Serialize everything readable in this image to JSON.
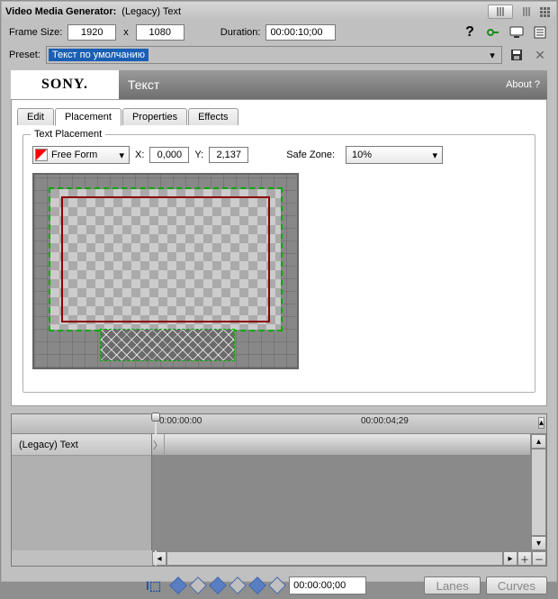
{
  "titlebar": {
    "title": "Video Media Generator:",
    "subtitle": "(Legacy) Text"
  },
  "frame": {
    "label": "Frame Size:",
    "w": "1920",
    "x": "x",
    "h": "1080"
  },
  "duration": {
    "label": "Duration:",
    "value": "00:00:10;00"
  },
  "preset": {
    "label": "Preset:",
    "value": "Текст по умолчанию"
  },
  "sony": {
    "brand": "SONY.",
    "title": "Текст",
    "about": "About  ?"
  },
  "tabs": {
    "edit": "Edit",
    "placement": "Placement",
    "properties": "Properties",
    "effects": "Effects"
  },
  "placement": {
    "legend": "Text Placement",
    "mode": "Free Form",
    "xLabel": "X:",
    "xVal": "0,000",
    "yLabel": "Y:",
    "yVal": "2,137",
    "safeZoneLabel": "Safe Zone:",
    "safeZoneVal": "10%"
  },
  "timeline": {
    "t0": "0:00:00:00",
    "t1": "00:00:04;29",
    "trackName": "(Legacy) Text"
  },
  "bottom": {
    "timecode": "00:00:00;00",
    "lanes": "Lanes",
    "curves": "Curves"
  }
}
